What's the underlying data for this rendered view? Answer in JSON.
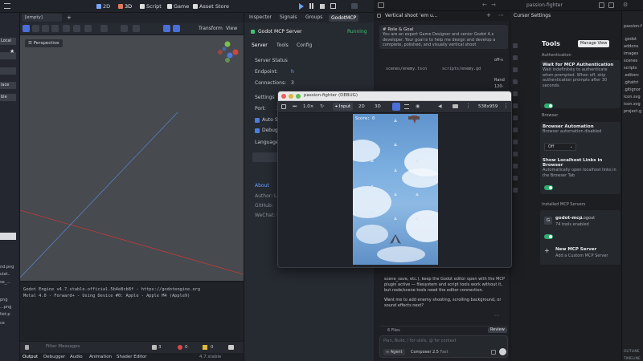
{
  "godot": {
    "workspaces": [
      "2D",
      "3D",
      "Script",
      "Game",
      "Asset Store"
    ],
    "scene_tab": "[empty]",
    "viewport_label": "Perspective",
    "toolbar": {
      "transform": "Transform",
      "view": "View"
    },
    "output_lines": [
      "Godot Engine v4.7.stable.official.5b4e8cb8f - https://godotengine.org",
      "Metal 4.0 - Forward+ - Using Device #0: Apple - Apple M4 (Apple9)"
    ],
    "filter_placeholder": "Filter Messages",
    "counts": {
      "errors": "3",
      "warnings": "0",
      "info": "0"
    },
    "bottom_tabs": [
      "Output",
      "Debugger",
      "Audio",
      "Animation",
      "Shader Editor"
    ],
    "version": "4.7.stable",
    "left_dock": {
      "items": [
        "Local",
        "",
        "",
        "lace",
        "ble"
      ],
      "files": [
        "nd.png",
        "ulat..",
        "se_...",
        "png",
        "...png",
        "liet.p",
        "ce"
      ]
    }
  },
  "right_dock": {
    "tabs": [
      "Inspector",
      "Signals",
      "Groups",
      "GodotMCP"
    ],
    "server_title": "Godot MCP Server",
    "server_state": "Running",
    "subtabs": [
      "Server",
      "Tools",
      "Config"
    ],
    "status_heading": "Server Status",
    "endpoint_label": "Endpoint:",
    "endpoint_value": "h",
    "connections_label": "Connections:",
    "connections_value": "3",
    "settings_heading": "Settings",
    "port_label": "Port:",
    "port_value": "3",
    "auto_label": "Auto St",
    "debug_label": "Debug",
    "language_label": "Language:",
    "about_heading": "About",
    "author_label": "Author: L",
    "github_label": "GitHub:",
    "wechat_label": "WeChat: h"
  },
  "debug_window": {
    "title": "passion-fighter (DEBUG)",
    "zoom": "1.0×",
    "input_label": "Input",
    "mode_2d": "2D",
    "mode_3d": "3D",
    "resolution": "538x959",
    "score": "Score: 0"
  },
  "cursor": {
    "window_title": "passion-fighter",
    "chat_title": "Vertical shoot 'em u...",
    "prompt_heading": "# Role & Goal",
    "prompt_text": "You are an expert Game Designer and senior Godot 4.x developer. Your goal is to help me design and develop a complete, polished, and visually vertical shoot",
    "code_chips": [
      "scenes/enemy.tscn",
      "scripts/enemy.gd"
    ],
    "side_snippets": [
      "off-s",
      "Rand",
      "120-",
      "collis",
      "hand"
    ],
    "response_text": "scene_save, etc.), keep the Godot editor open with the MCP plugin active — filesystem and script tools work without it, but node/scene tools need the editor connection.",
    "followup": "Want me to add enemy shooting, scrolling background, or sound effects next?",
    "files_label": "6 Files",
    "review_label": "Review",
    "input_placeholder": "Plan, Build, / for skills, @ for context",
    "agent_label": "Agent",
    "model_label": "Composer 2.5",
    "model_speed": "Fast"
  },
  "settings": {
    "header": "Cursor Settings",
    "tools_title": "Tools",
    "manage_view": "Manage View",
    "auth_heading": "Authentication",
    "auth_title": "Wait for MCP Authentication",
    "auth_desc": "Wait indefinitely to authenticate when prompted. When off, skip authentication prompts after 30 seconds.",
    "browser_heading": "Browser",
    "browser_auto_title": "Browser Automation",
    "browser_auto_desc": "Browser automation disabled",
    "browser_select": "Off",
    "localhost_title": "Show Localhost Links in Browser",
    "localhost_desc": "Automatically open localhost links in the Browser Tab",
    "installed_heading": "Installed MCP Servers",
    "server_name": "godot-mcp",
    "logout": "Logout",
    "tools_enabled": "74 tools enabled",
    "new_server_title": "New MCP Server",
    "new_server_desc": "Add a Custom MCP Server"
  },
  "file_tree": {
    "root": "passion-f",
    "items": [
      ".godot",
      "addons",
      "images",
      "scenes",
      "scripts",
      ".editorc",
      ".gitattri",
      ".gitignor",
      "icon.svg",
      "icon.svg",
      "project.g"
    ],
    "outline": "OUTLINE",
    "timeline": "TIMELINE"
  },
  "colors": {
    "accent": "#4a7de0",
    "running": "#3ec46d",
    "toggle": "#2fae6e"
  }
}
